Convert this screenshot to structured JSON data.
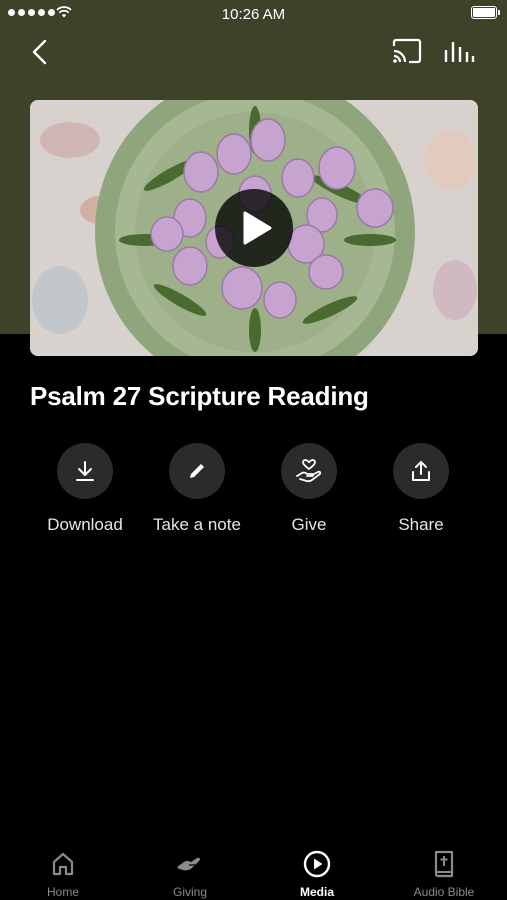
{
  "status_bar": {
    "time": "10:26 AM"
  },
  "header": {
    "back_icon": "chevron-left-icon",
    "cast_icon": "cast-icon",
    "audio_icon": "equalizer-icon"
  },
  "media": {
    "title": "Psalm 27 Scripture Reading",
    "play_icon": "play-icon"
  },
  "actions": [
    {
      "label": "Download",
      "icon": "download-icon"
    },
    {
      "label": "Take a note",
      "icon": "pencil-icon"
    },
    {
      "label": "Give",
      "icon": "give-heart-hand-icon"
    },
    {
      "label": "Share",
      "icon": "share-icon"
    }
  ],
  "tabs": [
    {
      "label": "Home",
      "icon": "home-icon",
      "active": false
    },
    {
      "label": "Giving",
      "icon": "giving-hand-icon",
      "active": false
    },
    {
      "label": "Media",
      "icon": "play-circle-icon",
      "active": true
    },
    {
      "label": "Audio Bible",
      "icon": "bible-icon",
      "active": false
    }
  ],
  "colors": {
    "header_bg": "#3c4329",
    "background": "#000000",
    "action_circle": "#2b2b2b",
    "inactive_tab": "#8a8a8a"
  }
}
